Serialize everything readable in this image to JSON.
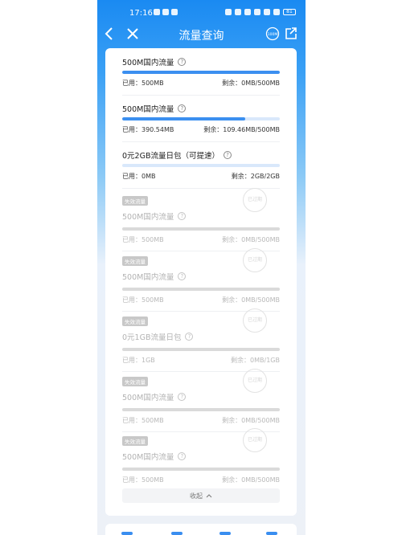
{
  "status": {
    "time": "17:16",
    "battery": "81"
  },
  "nav": {
    "title": "流量查询",
    "speed_label": "100M"
  },
  "packages": [
    {
      "name": "500M国内流量",
      "used": "已用：500MB",
      "remain": "剩余：0MB/500MB",
      "progress": 1.0
    },
    {
      "name": "500M国内流量",
      "used": "已用：390.54MB",
      "remain": "剩余：109.46MB/500MB",
      "progress": 0.78
    },
    {
      "name": "0元2GB流量日包（可提速）",
      "used": "已用：0MB",
      "remain": "剩余：2GB/2GB",
      "progress": 0.0
    }
  ],
  "expired": [
    {
      "tag": "失效流量",
      "stamp": "已过期",
      "name": "500M国内流量",
      "used": "已用：500MB",
      "remain": "剩余：0MB/500MB"
    },
    {
      "tag": "失效流量",
      "stamp": "已过期",
      "name": "500M国内流量",
      "used": "已用：500MB",
      "remain": "剩余：0MB/500MB"
    },
    {
      "tag": "失效流量",
      "stamp": "已过期",
      "name": "0元1GB流量日包",
      "used": "已用：1GB",
      "remain": "剩余：0MB/1GB"
    },
    {
      "tag": "失效流量",
      "stamp": "已过期",
      "name": "500M国内流量",
      "used": "已用：500MB",
      "remain": "剩余：0MB/500MB"
    },
    {
      "tag": "失效流量",
      "stamp": "已过期",
      "name": "500M国内流量",
      "used": "已用：500MB",
      "remain": "剩余：0MB/500MB"
    }
  ],
  "collapse_label": "收起",
  "colors": {
    "accent": "#3b8ff0",
    "header": "#1a8af2",
    "expired": "#b3b3b3"
  }
}
